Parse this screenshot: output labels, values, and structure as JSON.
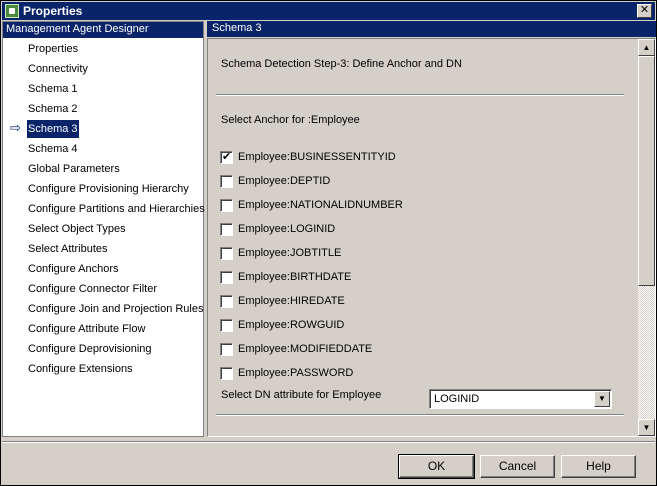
{
  "window": {
    "title": "Properties",
    "close_glyph": "✕"
  },
  "nav": {
    "header": "Management Agent Designer",
    "items": [
      {
        "label": "Properties"
      },
      {
        "label": "Connectivity"
      },
      {
        "label": "Schema 1"
      },
      {
        "label": "Schema 2"
      },
      {
        "label": "Schema 3",
        "selected": true
      },
      {
        "label": "Schema 4"
      },
      {
        "label": "Global Parameters"
      },
      {
        "label": "Configure Provisioning Hierarchy"
      },
      {
        "label": "Configure Partitions and Hierarchies"
      },
      {
        "label": "Select Object Types"
      },
      {
        "label": "Select Attributes"
      },
      {
        "label": "Configure Anchors"
      },
      {
        "label": "Configure Connector Filter"
      },
      {
        "label": "Configure Join and Projection Rules"
      },
      {
        "label": "Configure Attribute Flow"
      },
      {
        "label": "Configure Deprovisioning"
      },
      {
        "label": "Configure Extensions"
      }
    ]
  },
  "panel": {
    "header": "Schema 3",
    "step_text": "Schema Detection Step-3: Define Anchor and DN",
    "anchor_label": "Select Anchor for :Employee",
    "attributes": [
      {
        "label": "Employee:BUSINESSENTITYID",
        "checked": true
      },
      {
        "label": "Employee:DEPTID",
        "checked": false
      },
      {
        "label": "Employee:NATIONALIDNUMBER",
        "checked": false
      },
      {
        "label": "Employee:LOGINID",
        "checked": false
      },
      {
        "label": "Employee:JOBTITLE",
        "checked": false
      },
      {
        "label": "Employee:BIRTHDATE",
        "checked": false
      },
      {
        "label": "Employee:HIREDATE",
        "checked": false
      },
      {
        "label": "Employee:ROWGUID",
        "checked": false
      },
      {
        "label": "Employee:MODIFIEDDATE",
        "checked": false
      },
      {
        "label": "Employee:PASSWORD",
        "checked": false
      }
    ],
    "dn_label": "Select DN attribute for Employee",
    "dn_value": "LOGINID"
  },
  "buttons": {
    "ok": "OK",
    "cancel": "Cancel",
    "help": "Help"
  }
}
